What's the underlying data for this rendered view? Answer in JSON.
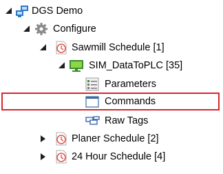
{
  "tree": {
    "root": {
      "label": "DGS Demo",
      "icon": "network-computers-icon",
      "expanded": true
    },
    "configure": {
      "label": "Configure",
      "icon": "gear-icon",
      "expanded": true
    },
    "sawmill": {
      "label": "Sawmill Schedule [1]",
      "icon": "clock-schedule-icon",
      "expanded": true
    },
    "sim": {
      "label": "SIM_DataToPLC [35]",
      "icon": "monitor-icon",
      "expanded": true
    },
    "parameters": {
      "label": "Parameters",
      "icon": "parameters-icon"
    },
    "commands": {
      "label": "Commands",
      "icon": "window-icon",
      "selected": true
    },
    "rawtags": {
      "label": "Raw Tags",
      "icon": "tags-icon"
    },
    "planer": {
      "label": "Planer Schedule [2]",
      "icon": "clock-schedule-icon",
      "expanded": false
    },
    "hour24": {
      "label": "24 Hour Schedule [4]",
      "icon": "clock-schedule-icon",
      "expanded": false
    }
  },
  "colors": {
    "selection_border": "#d9262c",
    "arrow": "#1e1e1e",
    "schedule_icon": "#e05a4e"
  }
}
